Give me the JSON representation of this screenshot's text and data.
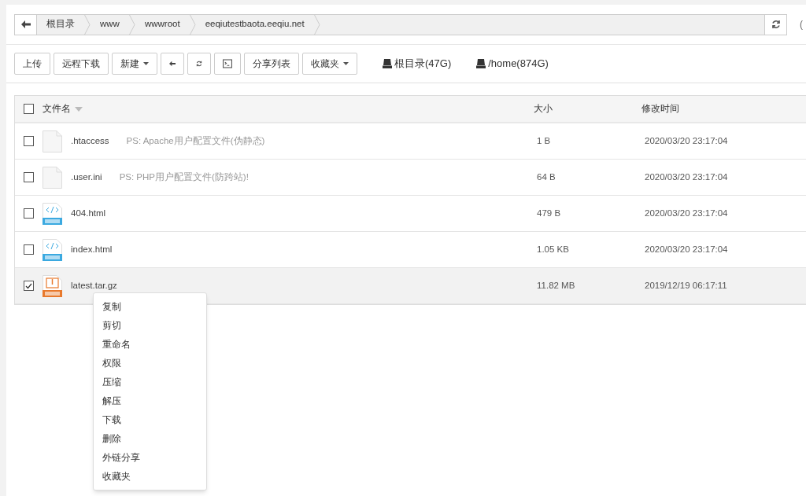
{
  "breadcrumb": {
    "items": [
      "根目录",
      "www",
      "wwwroot",
      "eeqiutestbaota.eeqiu.net"
    ],
    "right_text": "("
  },
  "toolbar": {
    "buttons": [
      {
        "kind": "text",
        "label": "上传"
      },
      {
        "kind": "text",
        "label": "远程下载"
      },
      {
        "kind": "dropdown",
        "label": "新建"
      },
      {
        "kind": "back"
      },
      {
        "kind": "refresh"
      },
      {
        "kind": "terminal"
      },
      {
        "kind": "text",
        "label": "分享列表"
      },
      {
        "kind": "dropdown",
        "label": "收藏夹"
      }
    ],
    "disks": [
      "根目录(47G)",
      "/home(874G)"
    ]
  },
  "table": {
    "select_all": {
      "checked": false
    },
    "columns": [
      "文件名",
      "大小",
      "修改时间"
    ],
    "rows": [
      {
        "kind": "blank",
        "name": ".htaccess",
        "note": "PS: Apache用户配置文件(伪静态)",
        "size": "1 B",
        "modified": "2020/03/20 23:17:04",
        "selected": false
      },
      {
        "kind": "blank",
        "name": ".user.ini",
        "note": "PS: PHP用户配置文件(防跨站)!",
        "size": "64 B",
        "modified": "2020/03/20 23:17:04",
        "selected": false
      },
      {
        "kind": "html",
        "name": "404.html",
        "size": "479 B",
        "modified": "2020/03/20 23:17:04",
        "selected": false
      },
      {
        "kind": "html",
        "name": "index.html",
        "size": "1.05 KB",
        "modified": "2020/03/20 23:17:04",
        "selected": false
      },
      {
        "kind": "archive",
        "name": "latest.tar.gz",
        "size": "11.82 MB",
        "modified": "2019/12/19 06:17:11",
        "selected": true
      }
    ]
  },
  "context_menu": [
    "复制",
    "剪切",
    "重命名",
    "权限",
    "压缩",
    "解压",
    "下载",
    "删除",
    "外链分享",
    "收藏夹"
  ]
}
